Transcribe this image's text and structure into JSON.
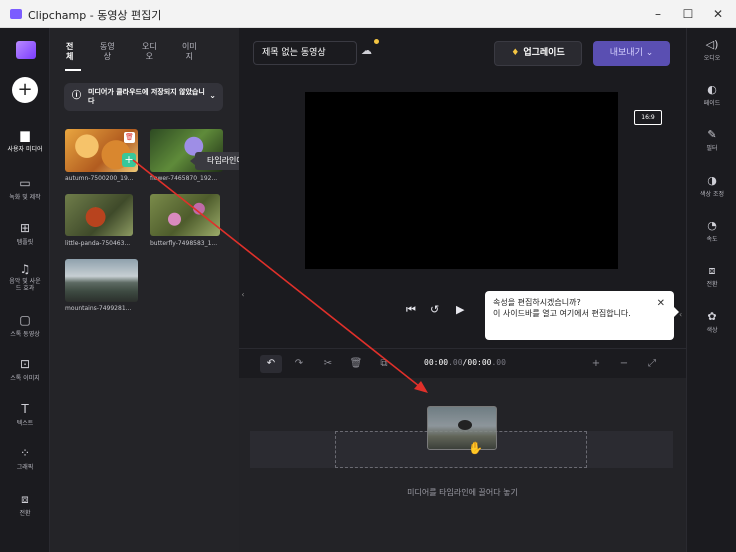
{
  "window": {
    "title": "Clipchamp - 동영상 편집기",
    "controls": {
      "minimize": "–",
      "maximize": "☐",
      "close": "✕"
    }
  },
  "left_rail": {
    "add_symbol": "+",
    "items": [
      {
        "label": "사용자 미디어",
        "icon": "folder-icon",
        "glyph": "▆"
      },
      {
        "label": "녹화 및 제작",
        "icon": "camera-icon",
        "glyph": "▭"
      },
      {
        "label": "템플릿",
        "icon": "template-icon",
        "glyph": "⊞"
      },
      {
        "label": "음악 및 사운드 효과",
        "icon": "music-icon",
        "glyph": "♫"
      },
      {
        "label": "스톡 동영상",
        "icon": "film-icon",
        "glyph": "▢"
      },
      {
        "label": "스톡 이미지",
        "icon": "image-icon",
        "glyph": "⊡"
      },
      {
        "label": "텍스트",
        "icon": "text-icon",
        "glyph": "T"
      },
      {
        "label": "그래픽",
        "icon": "shapes-icon",
        "glyph": "⁘"
      },
      {
        "label": "전환",
        "icon": "transition-icon",
        "glyph": "⧈"
      }
    ]
  },
  "media_panel": {
    "tabs": [
      {
        "label": "전\n체"
      },
      {
        "label": "동영\n상"
      },
      {
        "label": "오디\n오"
      },
      {
        "label": "이미\n지"
      }
    ],
    "cloud_note": "미디어가 클라우드에 저장되지 않았습니다",
    "items": [
      {
        "label": "autumn-7500200_19..."
      },
      {
        "label": "flower-7465870_192..."
      },
      {
        "label": "little-panda-750463..."
      },
      {
        "label": "butterfly-7498583_1..."
      },
      {
        "label": "mountains-7499281..."
      }
    ],
    "tooltip": "타임라인에 추가",
    "delete_glyph": "🗑",
    "add_glyph": "+"
  },
  "topbar": {
    "project_title": "제목 없는 동영상",
    "upgrade_label": "업그레이드",
    "upgrade_glyph": "♦",
    "export_label": "내보내기 ⌄"
  },
  "preview": {
    "aspect_ratio": "16:9",
    "controls": {
      "skip_back": "⏮",
      "rewind": "↺",
      "play": "▶"
    }
  },
  "properties_tip": {
    "heading": "속성을 편집하시겠습니까?",
    "body": "이 사이드바를 열고 여기에서 편집합니다.",
    "close": "✕"
  },
  "timeline": {
    "undo": "↶",
    "redo": "↷",
    "cut": "✂",
    "delete": "🗑",
    "duplicate": "⧉",
    "time_current": "00:00",
    "time_current_ms": ".00",
    "time_total": "00:00",
    "time_total_ms": ".00",
    "separator": "/",
    "zoom_in": "+",
    "zoom_out": "−",
    "fit": "⤢",
    "drop_hint": "미디어를 타임라인에 끌어다 놓기"
  },
  "right_rail": {
    "items": [
      {
        "label": "오디오",
        "icon": "audio-icon",
        "glyph": "◁)"
      },
      {
        "label": "페이드",
        "icon": "fade-icon",
        "glyph": "◐"
      },
      {
        "label": "필터",
        "icon": "filter-icon",
        "glyph": "✎"
      },
      {
        "label": "색상 조정",
        "icon": "color-adjust-icon",
        "glyph": "◑"
      },
      {
        "label": "속도",
        "icon": "speed-icon",
        "glyph": "◔"
      },
      {
        "label": "전환",
        "icon": "transition-icon",
        "glyph": "⧈"
      },
      {
        "label": "색상",
        "icon": "palette-icon",
        "glyph": "✿"
      }
    ]
  },
  "colors": {
    "accent": "#5a4fb2",
    "drag_arrow": "#e0302a",
    "add_button": "#37c79a",
    "gem": "#f4c542"
  }
}
